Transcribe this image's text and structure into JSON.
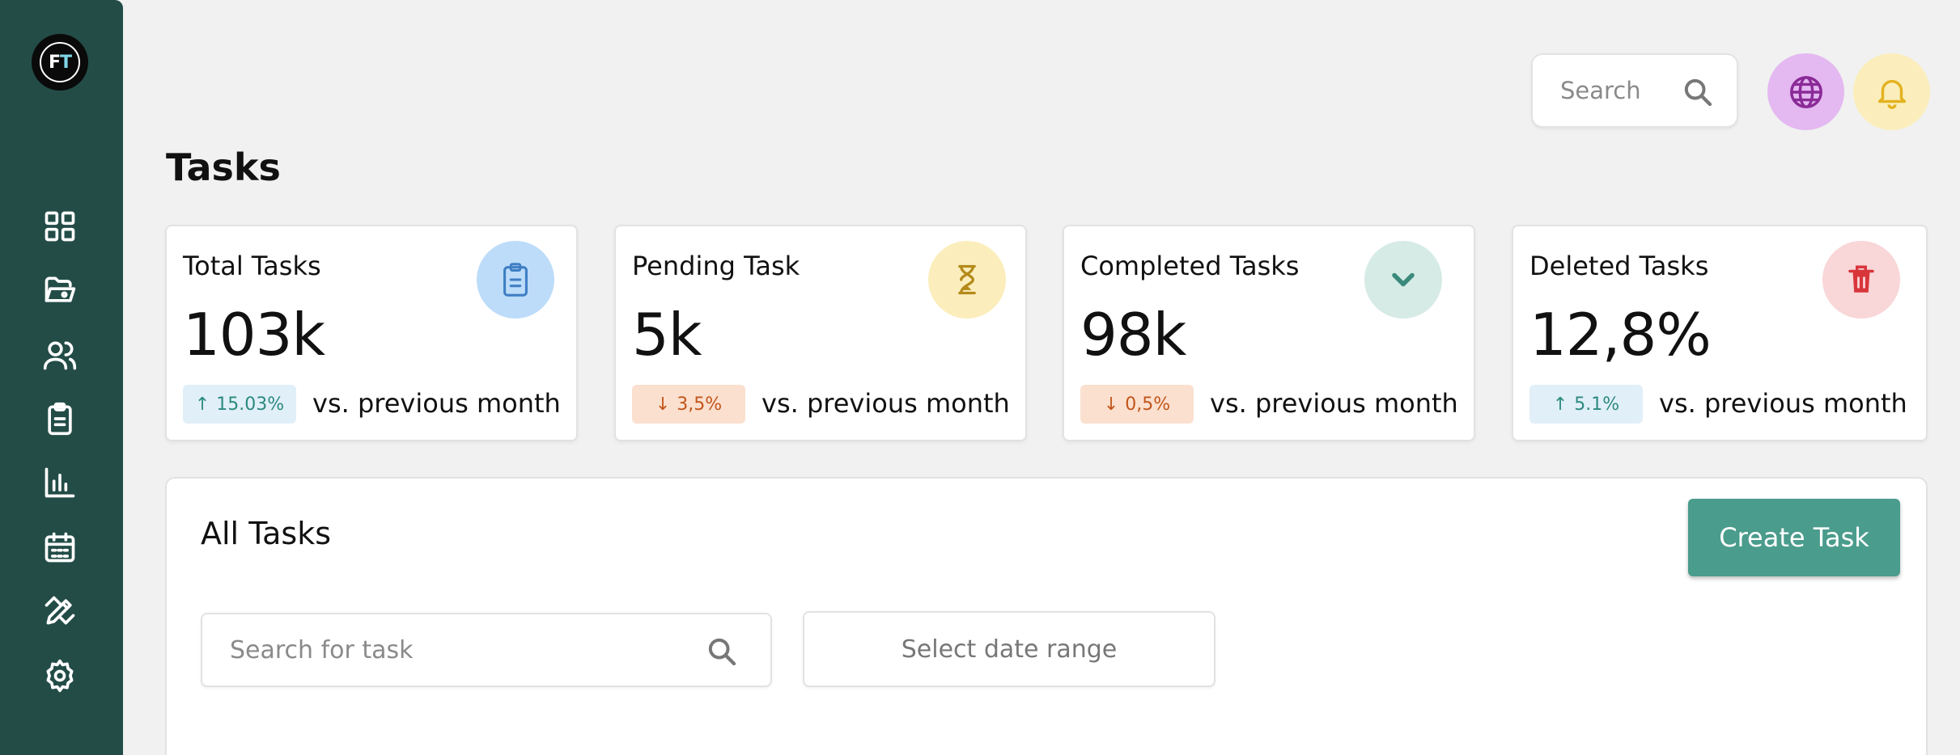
{
  "brand": {
    "logo_text_left": "F",
    "logo_text_right": "T"
  },
  "sidebar": {
    "items": [
      {
        "icon": "dashboard-grid-icon"
      },
      {
        "icon": "folder-icon"
      },
      {
        "icon": "users-icon"
      },
      {
        "icon": "clipboard-icon"
      },
      {
        "icon": "bar-chart-icon"
      },
      {
        "icon": "calendar-icon"
      },
      {
        "icon": "design-tools-icon"
      },
      {
        "icon": "settings-gear-icon"
      }
    ]
  },
  "header": {
    "search_placeholder": "Search",
    "globe_icon": "globe-icon",
    "bell_icon": "bell-icon"
  },
  "page": {
    "title": "Tasks"
  },
  "stats": [
    {
      "label": "Total Tasks",
      "value": "103k",
      "change": "15.03%",
      "direction": "up",
      "compare": "vs. previous month",
      "icon": "clipboard-icon",
      "icon_bg": "#bcdcf9",
      "icon_color": "#3f7fc4"
    },
    {
      "label": "Pending Task",
      "value": "5k",
      "change": "3,5%",
      "direction": "down",
      "compare": "vs. previous month",
      "icon": "hourglass-icon",
      "icon_bg": "#fbeebc",
      "icon_color": "#b58a1a"
    },
    {
      "label": "Completed Tasks",
      "value": "98k",
      "change": "0,5%",
      "direction": "down",
      "compare": "vs. previous month",
      "icon": "chevron-down-icon",
      "icon_bg": "#d6ebe6",
      "icon_color": "#3a8a7c"
    },
    {
      "label": "Deleted Tasks",
      "value": "12,8%",
      "change": "5.1%",
      "direction": "up",
      "compare": "vs. previous month",
      "icon": "trash-icon",
      "icon_bg": "#f9d6d8",
      "icon_color": "#d8353b"
    }
  ],
  "all_tasks": {
    "title": "All Tasks",
    "create_label": "Create Task",
    "search_placeholder": "Search for task",
    "date_range_label": "Select date range"
  },
  "colors": {
    "sidebar_bg": "#234c47",
    "accent": "#4a9c8c",
    "badge_up_bg": "#e1eff9",
    "badge_down_bg": "#fbe0cf"
  }
}
